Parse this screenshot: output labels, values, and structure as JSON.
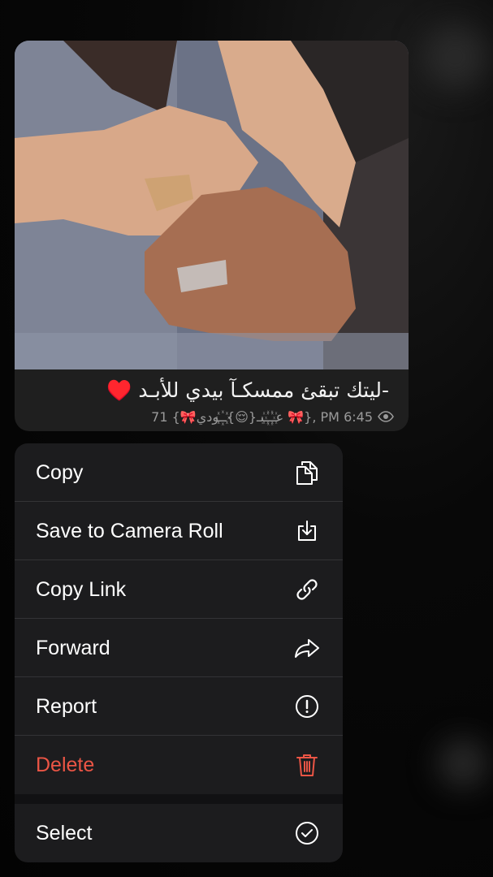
{
  "message": {
    "caption": "-ليتك تبقئ ممسكـآ بيدي للأبـد ♥️",
    "meta_text": "71 {🎀عـ꙰ـ꙰ـبـ{😌}ـ꙰꙰ـودي 🎀}, PM 6:45",
    "views_icon": "eye-icon"
  },
  "menu": {
    "items": [
      {
        "label": "Copy",
        "icon": "copy-icon"
      },
      {
        "label": "Save to Camera Roll",
        "icon": "save-download-icon"
      },
      {
        "label": "Copy Link",
        "icon": "link-icon"
      },
      {
        "label": "Forward",
        "icon": "forward-arrow-icon"
      },
      {
        "label": "Report",
        "icon": "exclamation-circle-icon"
      },
      {
        "label": "Delete",
        "icon": "trash-icon"
      },
      {
        "label": "Select",
        "icon": "check-circle-icon"
      }
    ]
  },
  "colors": {
    "menu_background": "#1c1c1e",
    "danger": "#eb5545",
    "text": "#ffffff"
  }
}
